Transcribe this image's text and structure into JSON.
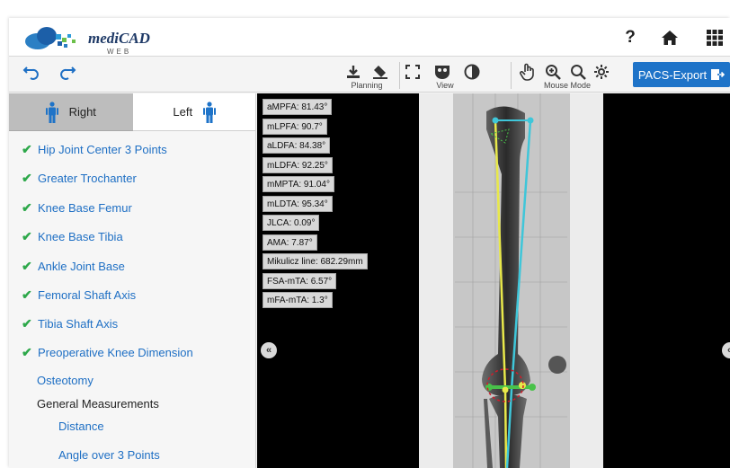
{
  "app": {
    "logo_text": "mediCAD",
    "logo_sub": "WEB"
  },
  "header": {
    "help_symbol": "?",
    "home_icon": "home-icon",
    "apps_icon": "grid-menu-icon"
  },
  "toolbar": {
    "undo_icon": "undo-icon",
    "redo_icon": "redo-icon",
    "groups": {
      "planning": "Planning",
      "view": "View",
      "mouse_mode": "Mouse Mode"
    },
    "pacs_export": "PACS-Export"
  },
  "sidebar": {
    "tabs": {
      "right": "Right",
      "left": "Left"
    },
    "steps": [
      "Hip Joint Center 3 Points",
      "Greater Trochanter",
      "Knee Base Femur",
      "Knee Base Tibia",
      "Ankle Joint Base",
      "Femoral Shaft Axis",
      "Tibia Shaft Axis",
      "Preoperative Knee Dimension"
    ],
    "osteotomy": "Osteotomy",
    "general_measurements": "General Measurements",
    "sub_items": [
      "Distance",
      "Angle over 3 Points"
    ]
  },
  "measurements": [
    "aMPFA: 81.43°",
    "mLPFA: 90.7°",
    "aLDFA: 84.38°",
    "mLDFA: 92.25°",
    "mMPTA: 91.04°",
    "mLDTA: 95.34°",
    "JLCA: 0.09°",
    "AMA: 7.87°",
    "Mikulicz line: 682.29mm",
    "FSA-mTA: 6.57°",
    "mFA-mTA: 1.3°"
  ],
  "colors": {
    "accent_blue": "#1e73c8",
    "link_blue": "#1e6fc4",
    "check_green": "#2da84a",
    "axis_cyan": "#3fc6d9",
    "axis_yellow": "#e8e84a",
    "marker_green": "#49c24a",
    "circle_red": "#d21c2a"
  }
}
